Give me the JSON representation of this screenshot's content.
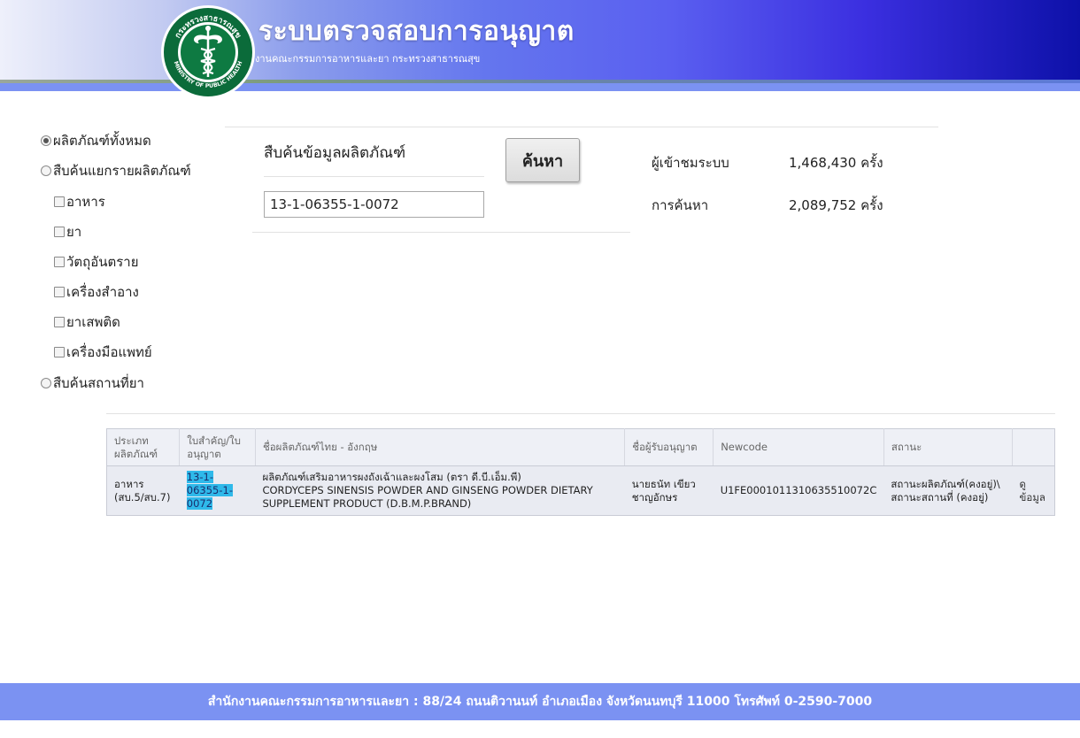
{
  "header": {
    "title": "ระบบตรวจสอบการอนุญาต",
    "subtitle": "งานคณะกรรมการอาหารและยา กระทรวงสาธารณสุข",
    "logo_text_top": "กระทรวงสาธารณสุข",
    "logo_text_bottom": "MINISTRY OF PUBLIC HEALTH"
  },
  "menu": {
    "all_products": "ผลิตภัณฑ์ทั้งหมด",
    "by_product": "สืบค้นแยกรายผลิตภัณฑ์",
    "categories": [
      "อาหาร",
      "ยา",
      "วัตถุอันตราย",
      "เครื่องสำอาง",
      "ยาเสพติด",
      "เครื่องมือแพทย์"
    ],
    "by_place": "สืบค้นสถานที่ยา",
    "selected": "all_products"
  },
  "search": {
    "heading": "สืบค้นข้อมูลผลิตภัณฑ์",
    "value": "13-1-06355-1-0072",
    "button_label": "ค้นหา"
  },
  "stats": {
    "visitors_label": "ผู้เข้าชมระบบ",
    "visitors_value": "1,468,430 ครั้ง",
    "searches_label": "การค้นหา",
    "searches_value": "2,089,752 ครั้ง"
  },
  "table": {
    "headers": [
      "ประเภท ผลิตภัณฑ์",
      "ใบสำคัญ/ใบ อนุญาต",
      "ชื่อผลิตภัณฑ์ไทย - อังกฤษ",
      "ชื่อผู้รับอนุญาต",
      "Newcode",
      "สถานะ",
      ""
    ],
    "rows": [
      {
        "type": "อาหาร (สบ.5/สบ.7)",
        "license": "13-1-06355-1-0072",
        "name_th": "ผลิตภัณฑ์เสริมอาหารผงถังเฉ้าและผงโสม (ตรา ดี.บี.เอ็ม.พี)",
        "name_en": "CORDYCEPS SINENSIS POWDER AND GINSENG POWDER DIETARY SUPPLEMENT PRODUCT (D.B.M.P.BRAND)",
        "licensee": "นายธนัท เขียวชาญอักษร",
        "newcode": "U1FE0001011310635510072C",
        "status": "สถานะผลิตภัณฑ์(คงอยู่)\\ สถานะสถานที่ (คงอยู่)",
        "action": "ดู ข้อมูล"
      }
    ]
  },
  "footer": {
    "text": "สำนักงานคณะกรรมการอาหารและยา : 88/24 ถนนติวานนท์ อำเภอเมือง จังหวัดนนทบุรี 11000 โทรศัพท์ 0-2590-7000"
  }
}
